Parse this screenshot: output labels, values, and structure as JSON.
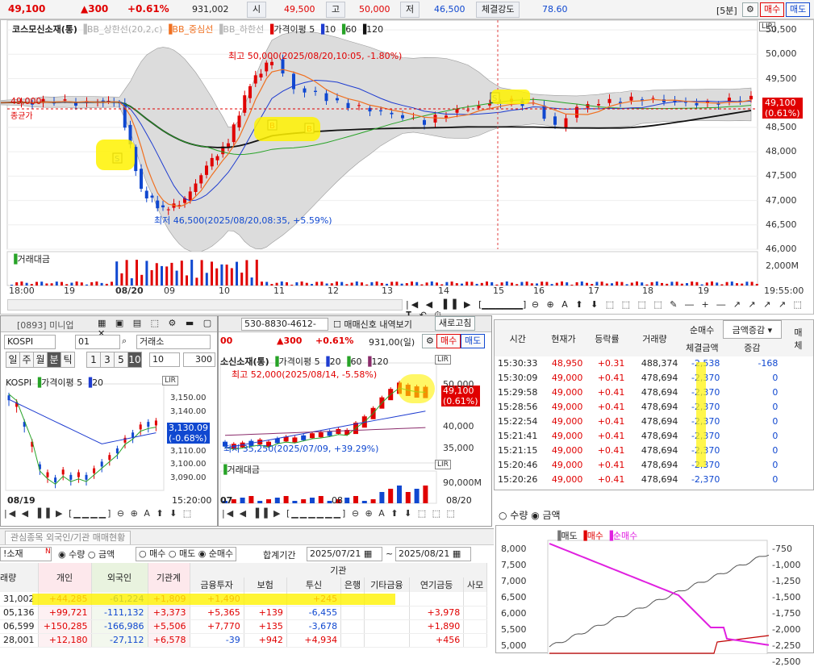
{
  "topbar": {
    "price": "49,100",
    "change": "▲300",
    "pct": "+0.61%",
    "volume": "931,002",
    "open_label": "시",
    "open": "49,500",
    "high_label": "고",
    "high": "50,000",
    "low_label": "저",
    "low": "46,500",
    "strength_label": "체결강도",
    "strength": "78.60",
    "period": "[5분]",
    "buy": "매수",
    "sell": "매도"
  },
  "main_chart": {
    "legend": {
      "name": "코스모신소재(통)",
      "bb_upper": "BB_상한선(20,2,c)",
      "bb_mid": "BB_중심선",
      "bb_lower": "BB_하한선",
      "price_avg": "가격이평 5",
      "ma10": "10",
      "ma60": "60",
      "ma120": "120"
    },
    "annot_high": "최고 50,000(2025/08/20,10:05, -1.80%)",
    "annot_low": "최저 46,500(2025/08/20,08:35, +5.59%)",
    "left_price": "49,000",
    "left_label": "종균가",
    "price_tag": "49,100",
    "price_tag_pct": "(0.61%)",
    "lir": "LIR",
    "yticks": [
      "50,500",
      "50,000",
      "49,500",
      "48,500",
      "48,000",
      "47,500",
      "47,000",
      "46,500",
      "46,000"
    ],
    "vol_label": "거래대금",
    "vol_tick": "2,000M",
    "xticks": [
      "18:00",
      "19",
      "08/20",
      "09",
      "10",
      "11",
      "12",
      "13",
      "14",
      "15",
      "16",
      "17",
      "18",
      "19",
      "19:55:00"
    ],
    "buy_mark": "B",
    "sell_mark": "S"
  },
  "chart_data": [
    {
      "type": "line",
      "title": "코스모신소재(통)",
      "ylim": [
        46000,
        50700
      ],
      "series": [
        {
          "name": "가격이평 5"
        },
        {
          "name": "10"
        },
        {
          "name": "60"
        },
        {
          "name": "120"
        }
      ],
      "values_close": [
        49000,
        49000,
        49050,
        49000,
        49050,
        49000,
        47200,
        46800,
        47000,
        47700,
        48200,
        49400,
        49900,
        49300,
        49200,
        49000,
        48900,
        48800,
        48700,
        48600,
        48800,
        48900,
        49000,
        49050,
        48950,
        48500,
        48900,
        49000,
        49050,
        49100,
        49050,
        49000,
        49000,
        49050,
        49100
      ]
    },
    {
      "type": "line",
      "title": "KOSPI",
      "yticks": [
        "3,150.00",
        "3,140.00",
        "3,130.00",
        "3,110.00",
        "3,100.00",
        "3,090.00"
      ],
      "ylim": [
        3085,
        3158
      ],
      "series": [
        {
          "name": "가격이평 5"
        },
        {
          "name": "20"
        }
      ]
    }
  ],
  "mini": {
    "header_code": "[0893] 미니업",
    "sub_code": "530-8830-4612-",
    "signal": "매매신호 내역보기",
    "refresh": "새로고침",
    "market": "KOSPI",
    "num": "01",
    "exchange": "거래소",
    "periods": [
      "일",
      "주",
      "월",
      "분",
      "틱"
    ],
    "nums": [
      "1",
      "3",
      "5",
      "10"
    ],
    "sel_n": "10",
    "count": "300",
    "kospi": "KOSPI",
    "price_avg": "가격이평 5",
    "ma20": "20",
    "lir": "LIR",
    "cur": "3,130.09",
    "cur_pct": "(-0.68%)",
    "date": "08/19",
    "time": "15:20:00"
  },
  "mid": {
    "prefix": "00",
    "change": "▲300",
    "pct": "+0.61%",
    "volume": "931,00(일)",
    "buy": "매수",
    "sell": "매도",
    "name": "소신소재(통)",
    "price_avg": "가격이평 5",
    "ma20": "20",
    "ma60": "60",
    "ma120": "120",
    "hi": "최고 52,000(2025/08/14, -5.58%)",
    "lo": "최저 35,250(2025/07/09, +39.29%)",
    "yticks": [
      "50,000",
      "40,000",
      "35,000"
    ],
    "vol_label": "거래대금",
    "vol_tick": "90,000M",
    "x1": "07",
    "x2": "08",
    "x3": "08/20",
    "tag": "49,100",
    "tag_pct": "(0.61%)",
    "lir": "LIR"
  },
  "ticks": {
    "headers": [
      "시간",
      "현재가",
      "등락률",
      "거래량",
      "순매수",
      "체결금액",
      "증감"
    ],
    "sel": "금액증감",
    "extra": "매",
    "extra2": "체",
    "rows": [
      [
        "15:30:33",
        "48,950",
        "+0.31",
        "488,374",
        "-2,538",
        "-168"
      ],
      [
        "15:30:09",
        "49,000",
        "+0.41",
        "478,694",
        "-2,370",
        "0"
      ],
      [
        "15:29:58",
        "49,000",
        "+0.41",
        "478,694",
        "-2,370",
        "0"
      ],
      [
        "15:28:56",
        "49,000",
        "+0.41",
        "478,694",
        "-2,370",
        "0"
      ],
      [
        "15:22:54",
        "49,000",
        "+0.41",
        "478,694",
        "-2,370",
        "0"
      ],
      [
        "15:21:41",
        "49,000",
        "+0.41",
        "478,694",
        "-2,370",
        "0"
      ],
      [
        "15:21:15",
        "49,000",
        "+0.41",
        "478,694",
        "-2,370",
        "0"
      ],
      [
        "15:20:46",
        "49,000",
        "+0.41",
        "478,694",
        "-2,370",
        "0"
      ],
      [
        "15:20:26",
        "49,000",
        "+0.41",
        "478,694",
        "-2,370",
        "0"
      ]
    ],
    "opt_qty": "수량",
    "opt_amt": "금액"
  },
  "flow": {
    "legend_sell": "매도",
    "legend_buy": "매수",
    "legend_net": "순매수",
    "yl": [
      "8,000",
      "7,500",
      "7,000",
      "6,500",
      "6,000",
      "5,500",
      "5,000"
    ],
    "yr": [
      "-750",
      "-1,000",
      "-1,250",
      "-1,500",
      "-1,750",
      "-2,000",
      "-2,250",
      "-2,500"
    ]
  },
  "bottom": {
    "tab": "관심종목 외국인/기관 매매현황",
    "code": "!소재",
    "qty": "수량",
    "amt": "금액",
    "buy": "매수",
    "sell": "매도",
    "net": "순매수",
    "period_label": "합계기간",
    "from": "2025/07/21",
    "to": "2025/08/21",
    "h1": [
      "래량",
      "개인",
      "외국인",
      "기관계"
    ],
    "inst": "기관",
    "h2": [
      "금융투자",
      "보험",
      "투신",
      "은행",
      "기타금융",
      "연기금등",
      "사모"
    ],
    "rows": [
      [
        "31,002",
        "+44,285",
        "-61,224",
        "+1,809",
        "+1,490",
        "",
        "+245",
        "",
        "",
        "",
        ""
      ],
      [
        "05,136",
        "+99,721",
        "-111,132",
        "+3,373",
        "+5,365",
        "+139",
        "-6,455",
        "",
        "",
        "+3,978",
        ""
      ],
      [
        "06,599",
        "+150,285",
        "-166,986",
        "+5,506",
        "+7,770",
        "+135",
        "-3,678",
        "",
        "",
        "+1,890",
        ""
      ],
      [
        "28,001",
        "+12,180",
        "-27,112",
        "+6,578",
        "-39",
        "+942",
        "+4,934",
        "",
        "",
        "+456",
        ""
      ]
    ]
  }
}
